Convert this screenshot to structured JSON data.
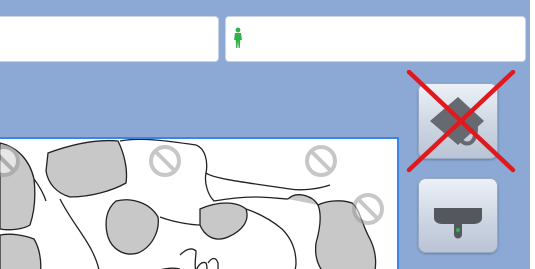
{
  "header": {
    "left_field_value": "",
    "right_field_value": "",
    "person_icon": "person-standing-icon"
  },
  "viewer": {
    "markers_icon": "no-entry-icon"
  },
  "toolbar": {
    "button1_icon": "bite-block-icon",
    "button1_state": "disabled-crossed",
    "button2_icon": "bite-block-holder-icon"
  },
  "colors": {
    "background": "#8ba9d4",
    "person_icon": "#2fb24a",
    "viewer_border": "#3a86e6",
    "cross": "#e0191f"
  }
}
